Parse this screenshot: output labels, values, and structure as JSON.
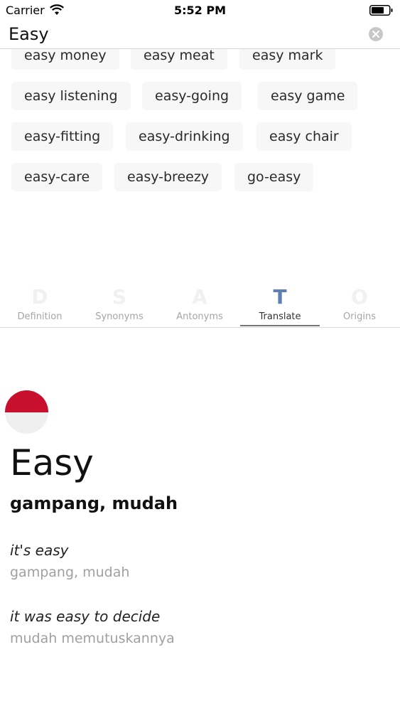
{
  "status_bar": {
    "carrier": "Carrier",
    "time": "5:52 PM"
  },
  "search": {
    "value": "Easy"
  },
  "related_words": [
    "easy money",
    "easy meat",
    "easy mark",
    "easy listening",
    "easy-going",
    "easy game",
    "easy-fitting",
    "easy-drinking",
    "easy chair",
    "easy-care",
    "easy-breezy",
    "go-easy"
  ],
  "tabs": [
    {
      "letter": "D",
      "label": "Definition"
    },
    {
      "letter": "S",
      "label": "Synonyms"
    },
    {
      "letter": "A",
      "label": "Antonyms"
    },
    {
      "letter": "T",
      "label": "Translate"
    },
    {
      "letter": "O",
      "label": "Origins"
    }
  ],
  "active_tab": "Translate",
  "translation": {
    "flag": "indonesia-flag-icon",
    "word": "Easy",
    "main": "gampang, mudah",
    "examples": [
      {
        "phrase": "it's easy",
        "translation": "gampang, mudah"
      },
      {
        "phrase": "it was easy to decide",
        "translation": "mudah memutuskannya"
      }
    ]
  },
  "colors": {
    "accent": "#5d7fb3",
    "flag_red": "#c8102e",
    "chip_bg": "#f7f7f7"
  }
}
